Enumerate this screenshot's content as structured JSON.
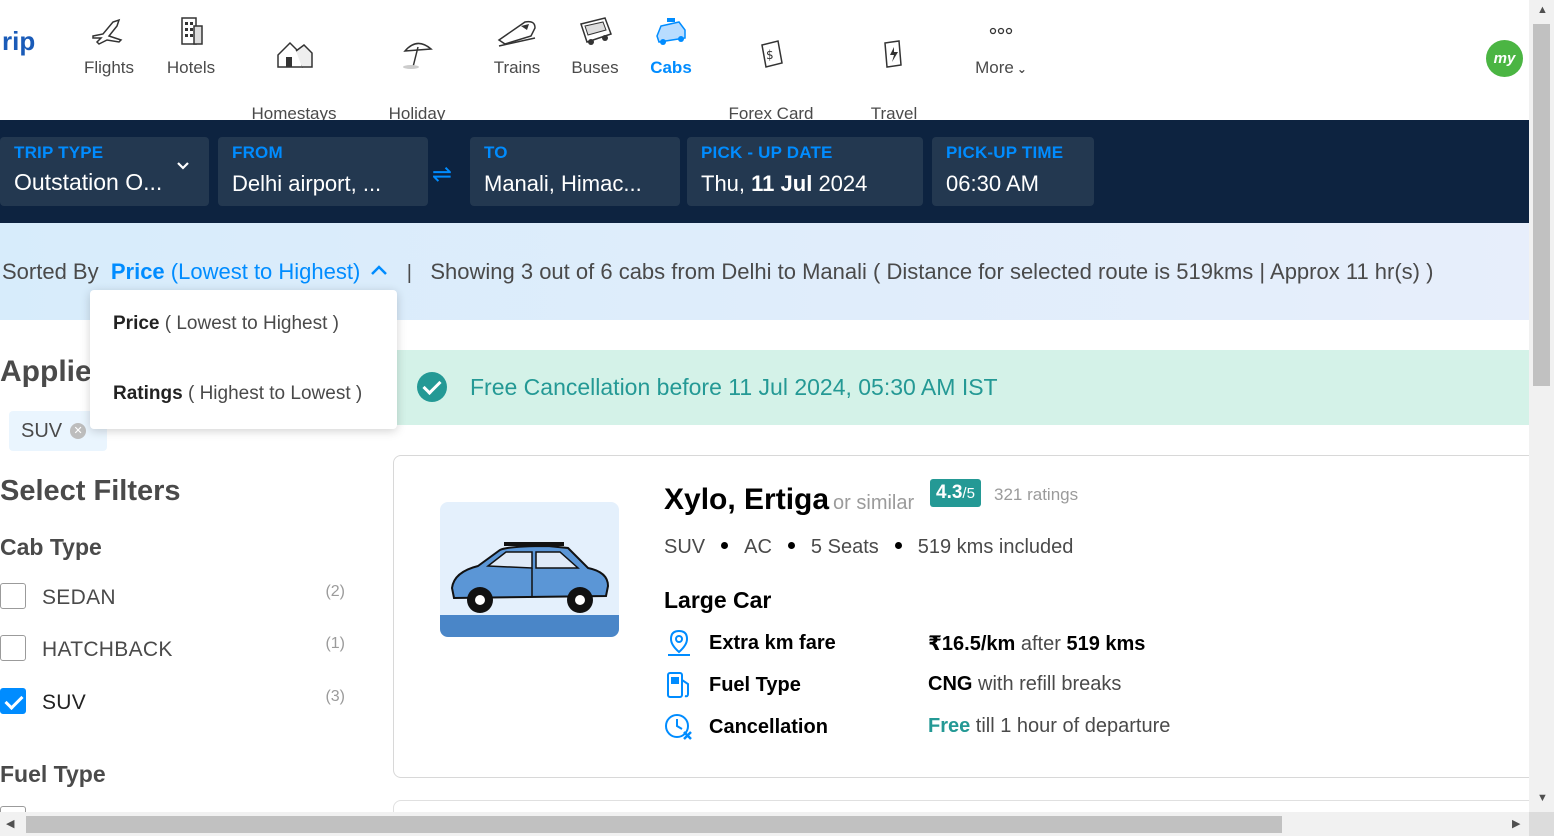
{
  "brand": {
    "partial_text": "rip"
  },
  "nav": {
    "items": [
      {
        "label": "Flights",
        "icon": "airplane-icon"
      },
      {
        "label": "Hotels",
        "icon": "hotel-icon"
      },
      {
        "label": "Homestays\n& Villas",
        "icon": "homestay-icon"
      },
      {
        "label": "Holiday\nPackages",
        "icon": "beach-umbrella-icon"
      },
      {
        "label": "Trains",
        "icon": "train-icon"
      },
      {
        "label": "Buses",
        "icon": "bus-icon"
      },
      {
        "label": "Cabs",
        "icon": "cab-icon",
        "active": true
      },
      {
        "label": "Forex Card\n& Currency",
        "icon": "forex-icon"
      },
      {
        "label": "Travel\nInsurance",
        "icon": "insurance-icon"
      },
      {
        "label": "More",
        "icon": "more-dots-icon"
      }
    ],
    "avatar": "my"
  },
  "search": {
    "trip_type": {
      "label": "TRIP TYPE",
      "value": "Outstation O..."
    },
    "from": {
      "label": "FROM",
      "value": "Delhi airport, ..."
    },
    "to": {
      "label": "TO",
      "value": "Manali, Himac..."
    },
    "pickup_date": {
      "label": "PICK - UP DATE",
      "day": "Thu,",
      "date": "11 Jul",
      "year": "2024"
    },
    "pickup_time": {
      "label": "PICK-UP TIME",
      "value": "06:30 AM"
    },
    "swap_icon": "⇌"
  },
  "sort": {
    "prefix": "Sorted By",
    "selected_key": "Price",
    "selected_sub": "(Lowest to Highest)",
    "separator": "|",
    "summary": "Showing 3 out of 6 cabs from Delhi to Manali ( Distance for selected route is 519kms | Approx 11 hr(s) )",
    "options": [
      {
        "key": "Price",
        "sub": " ( Lowest to Highest )"
      },
      {
        "key": "Ratings",
        "sub": " ( Highest to Lowest )"
      }
    ]
  },
  "filters": {
    "applied_title": "Applied Filters",
    "applied_chips": [
      "SUV"
    ],
    "select_title": "Select Filters",
    "cab_type_title": "Cab Type",
    "cab_types": [
      {
        "label": "SEDAN",
        "count": "(2)",
        "checked": false
      },
      {
        "label": "HATCHBACK",
        "count": "(1)",
        "checked": false
      },
      {
        "label": "SUV",
        "count": "(3)",
        "checked": true
      }
    ],
    "fuel_type_title": "Fuel Type"
  },
  "banner": {
    "text": "Free Cancellation before 11 Jul 2024, 05:30 AM IST"
  },
  "cab": {
    "title": "Xylo, Ertiga",
    "similar": "or similar",
    "rating": "4.3",
    "rating_of": "/5",
    "rating_count": "321 ratings",
    "specs": [
      "SUV",
      "AC",
      "5 Seats",
      "519 kms included"
    ],
    "class": "Large Car",
    "features": [
      {
        "icon": "location-pin-icon",
        "label": "Extra km fare",
        "value_main": "₹16.5/km",
        "value_mid": " after ",
        "value_bold": "519 kms",
        "value_tail": ""
      },
      {
        "icon": "fuel-pump-icon",
        "label": "Fuel Type",
        "value_main": "CNG",
        "value_mid": " with refill breaks",
        "value_bold": "",
        "value_tail": ""
      },
      {
        "icon": "clock-cancel-icon",
        "label": "Cancellation",
        "value_green": "Free",
        "value_mid": " till 1 hour of departure"
      }
    ]
  },
  "colors": {
    "accent": "#008cff",
    "navy": "#0d2340",
    "teal": "#249995",
    "mint": "#d4f2e8"
  }
}
